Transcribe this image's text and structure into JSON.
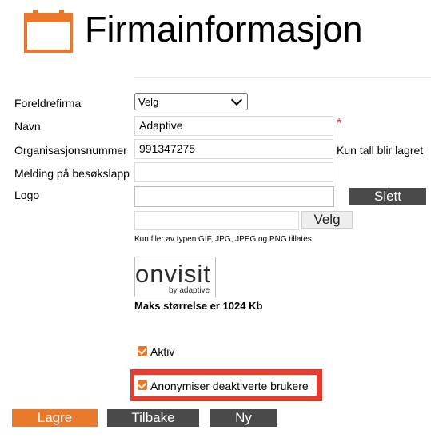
{
  "header": {
    "title": "Firmainformasjon",
    "icon": "calendar-icon"
  },
  "form": {
    "parent_company": {
      "label": "Foreldrefirma",
      "selected": "Velg"
    },
    "name": {
      "label": "Navn",
      "value": "Adaptive",
      "required_mark": "*"
    },
    "org_number": {
      "label": "Organisasjonsnummer",
      "value": "991347275",
      "hint": "Kun tall blir lagret"
    },
    "visitor_message": {
      "label": "Melding på besøkslapp",
      "value": ""
    },
    "logo": {
      "label": "Logo",
      "value": "",
      "delete_label": "Slett",
      "file_value": "",
      "choose_label": "Velg",
      "help": "Kun filer av typen GIF, JPG, JPEG og PNG tillates",
      "preview_text": "onvisit",
      "preview_subtext": "by adaptive",
      "max_size": "Maks størrelse er 1024 Kb"
    },
    "active": {
      "label": "Aktiv",
      "checked": true
    },
    "anonymize": {
      "label": "Anonymiser deaktiverte brukere",
      "checked": true
    }
  },
  "actions": {
    "save": "Lagre",
    "back": "Tilbake",
    "new": "Ny"
  },
  "colors": {
    "accent": "#e8782a",
    "dark_button": "#4a4a4a",
    "highlight": "#e43c2f",
    "required": "#e03030"
  }
}
